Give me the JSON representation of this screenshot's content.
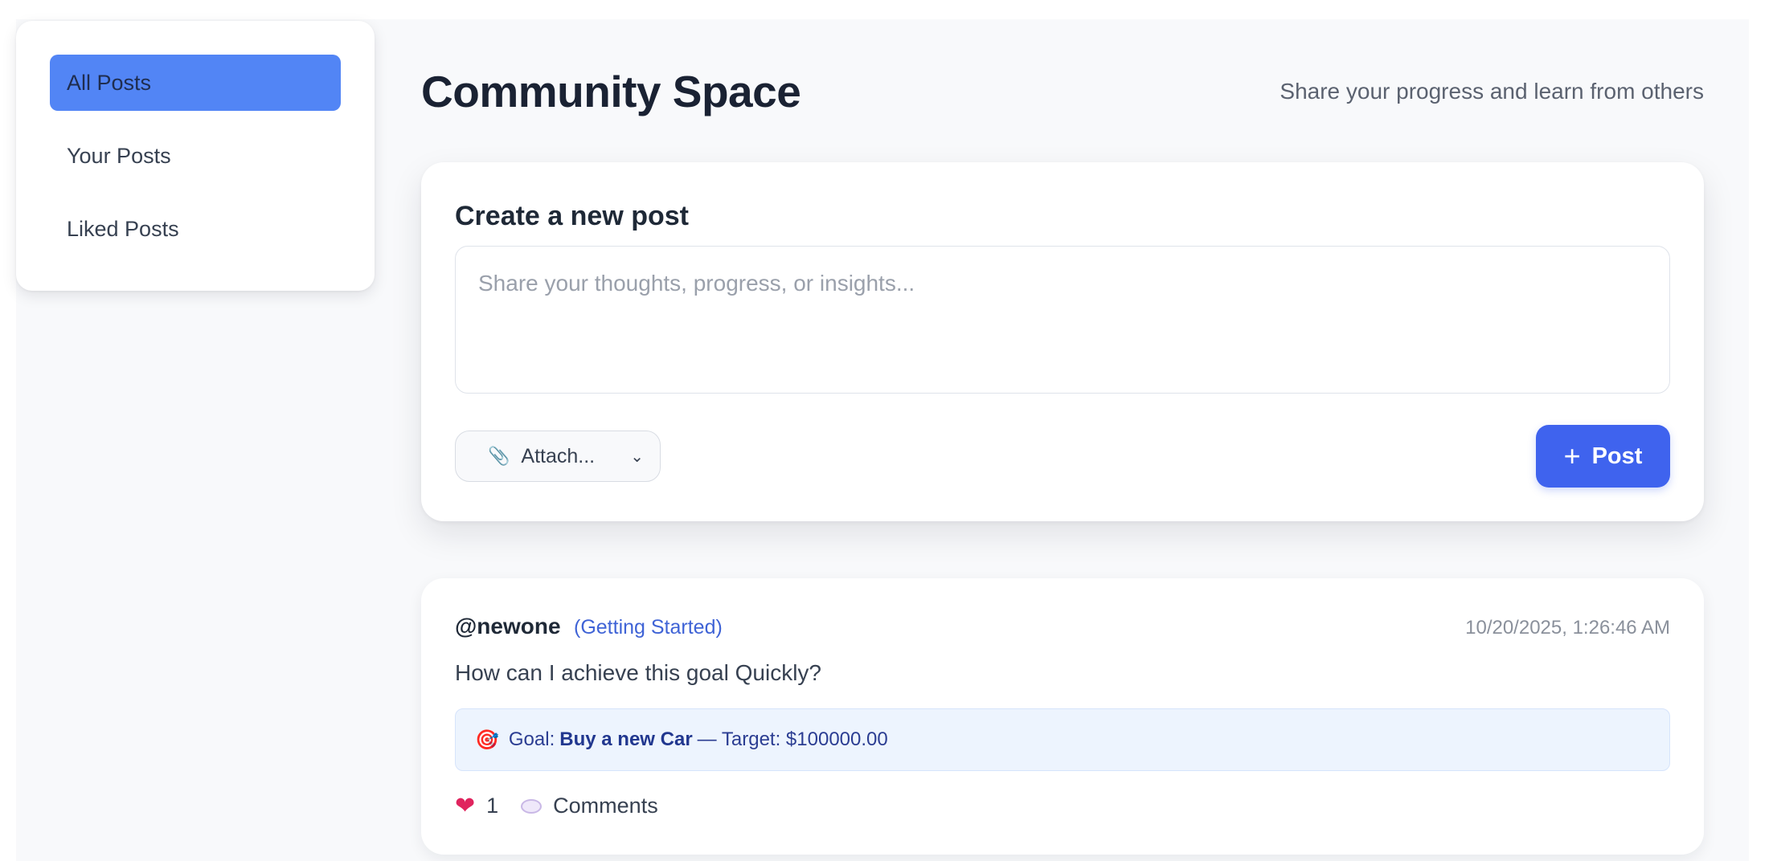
{
  "sidebar": {
    "items": [
      {
        "label": "All Posts",
        "active": true
      },
      {
        "label": "Your Posts",
        "active": false
      },
      {
        "label": "Liked Posts",
        "active": false
      }
    ]
  },
  "header": {
    "title": "Community Space",
    "subtitle": "Share your progress and learn from others"
  },
  "composer": {
    "title": "Create a new post",
    "placeholder": "Share your thoughts, progress, or insights...",
    "attach_label": "Attach...",
    "post_label": "Post"
  },
  "posts": [
    {
      "author": "@newone",
      "tag": "(Getting Started)",
      "timestamp": "10/20/2025, 1:26:46 AM",
      "body": "How can I achieve this goal Quickly?",
      "goal": {
        "prefix": "Goal:",
        "name": "Buy a new Car",
        "target_text": "— Target: $100000.00"
      },
      "likes": "1",
      "comments_label": "Comments"
    }
  ],
  "colors": {
    "accent": "#3f63ee",
    "nav_active": "#5285f5",
    "tag": "#3f63d6",
    "goal_bg": "#edf4fe",
    "heart": "#e0245e"
  },
  "icons": {
    "attach": "paperclip-icon",
    "select": "chevron-down-icon",
    "post": "plus-icon",
    "goal": "target-icon",
    "like": "heart-icon",
    "comment": "speech-bubble-icon"
  }
}
